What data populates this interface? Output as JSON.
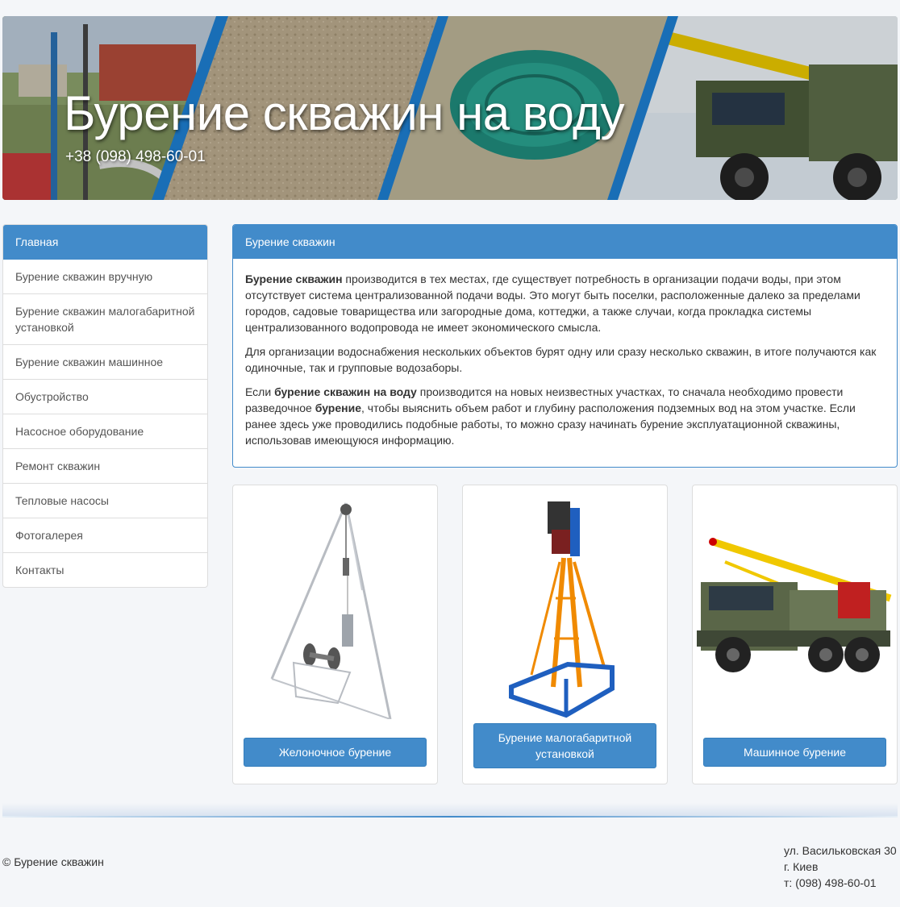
{
  "header": {
    "title": "Бурение скважин на воду",
    "phone": "+38 (098) 498-60-01"
  },
  "sidebar": {
    "items": [
      {
        "label": "Главная",
        "active": true
      },
      {
        "label": "Бурение скважин вручную"
      },
      {
        "label": "Бурение скважин малогабаритной установкой"
      },
      {
        "label": "Бурение скважин машинное"
      },
      {
        "label": "Обустройство"
      },
      {
        "label": "Насосное оборудование"
      },
      {
        "label": "Ремонт скважин"
      },
      {
        "label": "Тепловые насосы"
      },
      {
        "label": "Фотогалерея"
      },
      {
        "label": "Контакты"
      }
    ]
  },
  "main": {
    "panel_title": "Бурение скважин",
    "p1_bold": "Бурение скважин",
    "p1_rest": " производится в тех местах, где существует потребность в организации подачи воды, при этом отсутствует система централизованной подачи воды. Это могут быть поселки, расположенные далеко за пределами городов, садовые товарищества или загородные дома, коттеджи, а также случаи, когда прокладка системы централизованного водопровода не имеет экономического смысла.",
    "p2": "Для организации водоснабжения нескольких объектов бурят одну или сразу несколько скважин, в итоге получаются как одиночные, так и групповые водозаборы.",
    "p3_a": "Если ",
    "p3_bold1": "бурение скважин на воду",
    "p3_b": " производится на новых неизвестных участках, то сначала необходимо провести разведочное ",
    "p3_bold2": "бурение",
    "p3_c": ", чтобы выяснить объем работ и глубину расположения подземных вод на этом участке. Если ранее здесь уже проводились подобные работы, то можно сразу начинать бурение эксплуатационной скважины, использовав имеющуюся информацию."
  },
  "cards": [
    {
      "button": "Желоночное бурение"
    },
    {
      "button": "Бурение малогабаритной установкой"
    },
    {
      "button": "Машинное бурение"
    }
  ],
  "footer": {
    "copyright": "© Бурение скважин",
    "address_line1": "ул. Васильковская 30",
    "address_line2": "г. Киев",
    "address_line3": "т: (098) 498-60-01"
  },
  "colors": {
    "accent": "#428bca",
    "text": "#333333"
  }
}
